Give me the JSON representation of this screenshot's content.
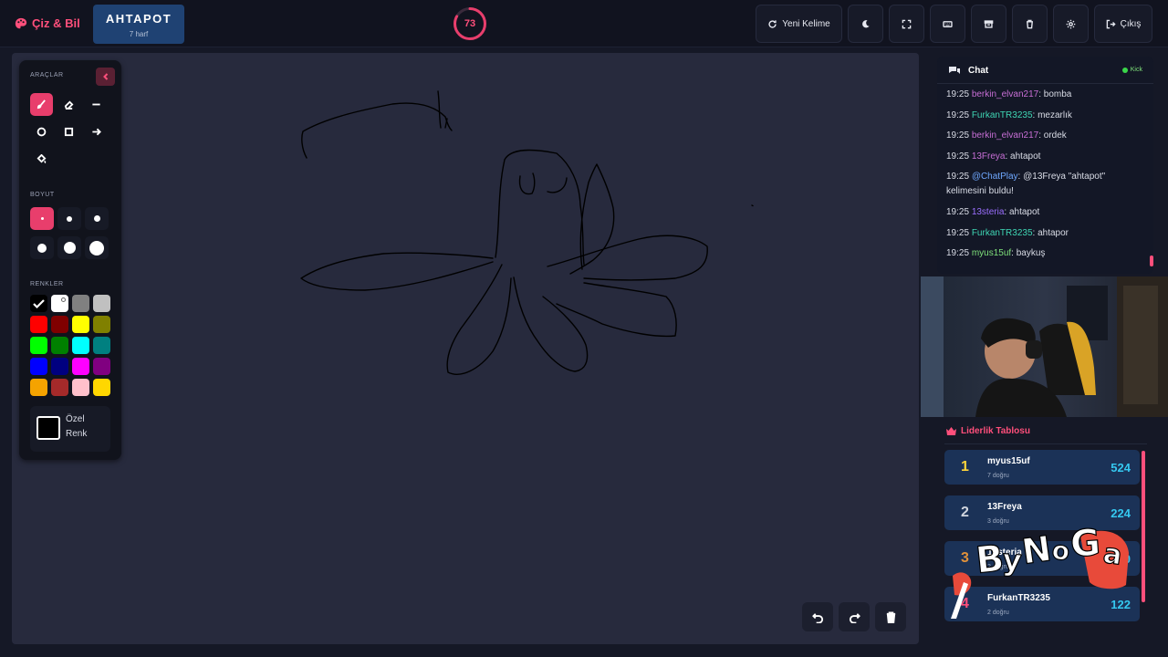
{
  "app": {
    "brand": "Çiz & Bil"
  },
  "word": {
    "text": "AHTAPOT",
    "hint": "7 harf"
  },
  "timer": {
    "value": "73",
    "remaining_fraction": 0.83
  },
  "toolbar": {
    "new_word": "Yeni Kelime",
    "exit": "Çıkış"
  },
  "panel": {
    "tools_label": "ARAÇLAR",
    "size_label": "BOYUT",
    "colors_label": "RENKLER",
    "custom_color_line1": "Özel",
    "custom_color_line2": "Renk"
  },
  "colors": [
    "#000000",
    "#ffffff",
    "#808080",
    "#c0c0c0",
    "#ff0000",
    "#800000",
    "#ffff00",
    "#808000",
    "#00ff00",
    "#008000",
    "#00ffff",
    "#008080",
    "#0000ff",
    "#000080",
    "#ff00ff",
    "#800080",
    "#f5a300",
    "#a52a2a",
    "#ffc0cb",
    "#ffd700"
  ],
  "chat": {
    "title": "Chat",
    "platform": "Kick",
    "messages": [
      {
        "time": "19:25",
        "user": "berkin_elvan217",
        "user_color": "#c86fd6",
        "text": ": bomba"
      },
      {
        "time": "19:25",
        "user": "FurkanTR3235",
        "user_color": "#3fd6b4",
        "text": ": mezarlık"
      },
      {
        "time": "19:25",
        "user": "berkin_elvan217",
        "user_color": "#c86fd6",
        "text": ": ordek"
      },
      {
        "time": "19:25",
        "user": "13Freya",
        "user_color": "#c86fd6",
        "text": ": ahtapot"
      },
      {
        "time": "19:25",
        "user": "@ChatPlay",
        "user_color": "#6fa8ff",
        "text": ": @13Freya \"ahtapot\" kelimesini buldu!"
      },
      {
        "time": "19:25",
        "user": "13steria",
        "user_color": "#9b6fff",
        "text": ": ahtapot"
      },
      {
        "time": "19:25",
        "user": "FurkanTR3235",
        "user_color": "#3fd6b4",
        "text": ": ahtapor"
      },
      {
        "time": "19:25",
        "user": "myus15uf",
        "user_color": "#7ee07a",
        "text": ": baykuş"
      }
    ]
  },
  "leaderboard": {
    "title": "Liderlik Tablosu",
    "rows": [
      {
        "rank": "1",
        "name": "myus15uf",
        "sub": "7 doğru",
        "score": "524",
        "rank_color": "#ffd43b"
      },
      {
        "rank": "2",
        "name": "13Freya",
        "sub": "3 doğru",
        "score": "224",
        "rank_color": "#d0d5de"
      },
      {
        "rank": "3",
        "name": "13steria",
        "sub": "2 doğru",
        "score": "200",
        "rank_color": "#e0913a"
      },
      {
        "rank": "4",
        "name": "FurkanTR3235",
        "sub": "2 doğru",
        "score": "122",
        "rank_color": "#ff4f7b"
      }
    ]
  },
  "watermark": {
    "text": "ByNoGa"
  }
}
